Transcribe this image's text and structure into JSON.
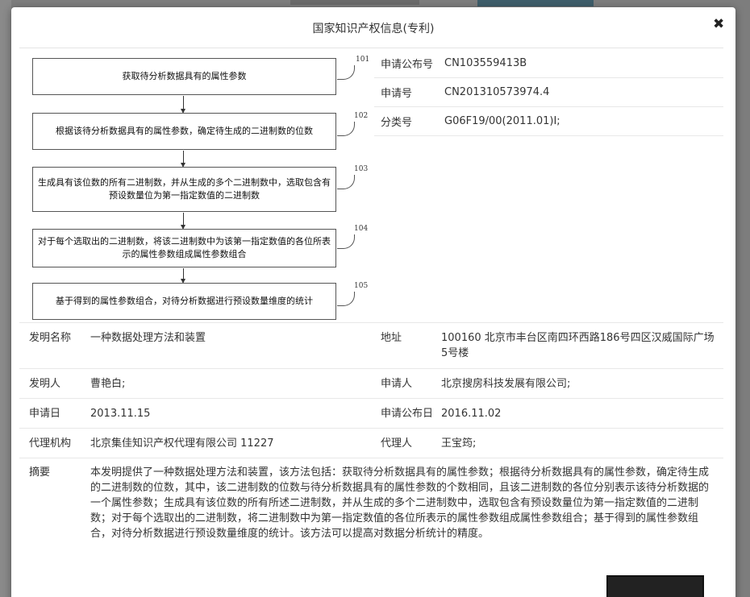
{
  "modal": {
    "title": "国家知识产权信息(专利)",
    "close_symbol": "✖"
  },
  "flowchart": {
    "steps": [
      {
        "num": "101",
        "text": "获取待分析数据具有的属性参数"
      },
      {
        "num": "102",
        "text": "根据该待分析数据具有的属性参数，确定待生成的二进制数的位数"
      },
      {
        "num": "103",
        "text": "生成具有该位数的所有二进制数，并从生成的多个二进制数中，选取包含有预设数量位为第一指定数值的二进制数"
      },
      {
        "num": "104",
        "text": "对于每个选取出的二进制数，将该二进制数中为该第一指定数值的各位所表示的属性参数组成属性参数组合"
      },
      {
        "num": "105",
        "text": "基于得到的属性参数组合，对待分析数据进行预设数量维度的统计"
      }
    ]
  },
  "info": {
    "pub_no_label": "申请公布号",
    "pub_no": "CN103559413B",
    "app_no_label": "申请号",
    "app_no": "CN201310573974.4",
    "class_label": "分类号",
    "class": "G06F19/00(2011.01)I;"
  },
  "details": {
    "name_label": "发明名称",
    "name": "一种数据处理方法和装置",
    "address_label": "地址",
    "address": "100160 北京市丰台区南四环西路186号四区汉威国际广场5号楼",
    "inventor_label": "发明人",
    "inventor": "曹艳白;",
    "applicant_label": "申请人",
    "applicant": "北京搜房科技发展有限公司;",
    "app_date_label": "申请日",
    "app_date": "2013.11.15",
    "pub_date_label": "申请公布日",
    "pub_date": "2016.11.02",
    "agency_label": "代理机构",
    "agency": "北京集佳知识产权代理有限公司 11227",
    "agent_label": "代理人",
    "agent": "王宝筠;",
    "abstract_label": "摘要",
    "abstract": "本发明提供了一种数据处理方法和装置，该方法包括：获取待分析数据具有的属性参数；根据待分析数据具有的属性参数，确定待生成的二进制数的位数，其中，该二进制数的位数与待分析数据具有的属性参数的个数相同，且该二进制数的各位分别表示该待分析数据的一个属性参数；生成具有该位数的所有所述二进制数，并从生成的多个二进制数中，选取包含有预设数量位为第一指定数值的二进制数；对于每个选取出的二进制数，将二进制数中为第一指定数值的各位所表示的属性参数组成属性参数组合；基于得到的属性参数组合，对待分析数据进行预设数量维度的统计。该方法可以提高对数据分析统计的精度。"
  }
}
